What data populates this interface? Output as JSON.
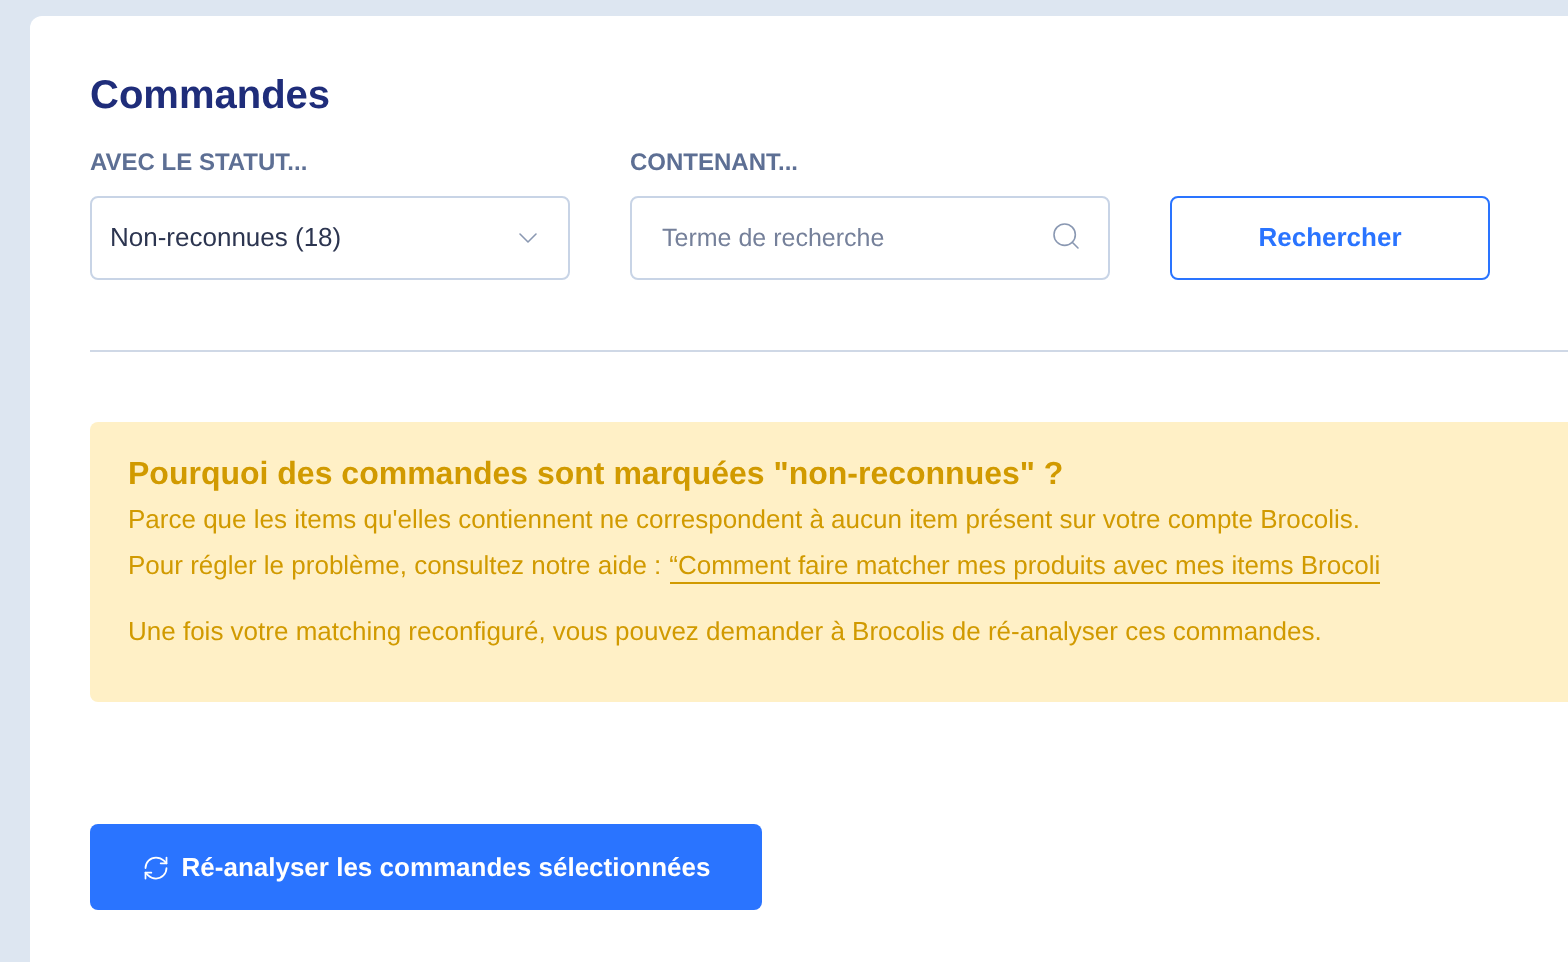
{
  "title": "Commandes",
  "filters": {
    "status_label": "AVEC LE STATUT...",
    "status_value": "Non-reconnues (18)",
    "search_label": "CONTENANT...",
    "search_placeholder": "Terme de recherche",
    "search_button": "Rechercher"
  },
  "notice": {
    "heading": "Pourquoi des commandes sont marquées \"non-reconnues\" ?",
    "line_1": "Parce que les items qu'elles contiennent ne correspondent à aucun item présent sur votre compte Brocolis.",
    "line_2": "Pour régler le problème, consultez notre aide :",
    "link": "“Comment faire matcher mes produits avec mes items Brocoli",
    "line_3": "Une fois votre matching reconfiguré, vous pouvez demander à Brocolis de ré-analyser ces commandes."
  },
  "action_button": "Ré-analyser les commandes sélectionnées"
}
